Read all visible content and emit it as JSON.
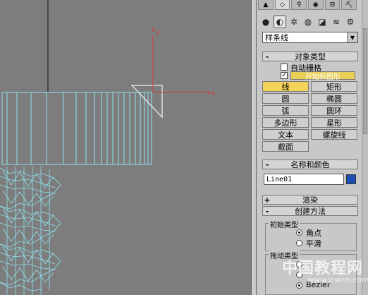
{
  "viewport": {
    "axis_y_label": "y",
    "axis_x_label": "x"
  },
  "panel": {
    "tabs": [
      "▲",
      "◇",
      "⚲",
      "◉",
      "⊟",
      "⛏"
    ],
    "icons": [
      {
        "name": "geometry-icon",
        "glyph": "●"
      },
      {
        "name": "shapes-icon",
        "glyph": "◐"
      },
      {
        "name": "lights-icon",
        "glyph": "✲"
      },
      {
        "name": "cameras-icon",
        "glyph": "◍"
      },
      {
        "name": "helpers-icon",
        "glyph": "◪"
      },
      {
        "name": "spacewarps-icon",
        "glyph": "≋"
      },
      {
        "name": "systems-icon",
        "glyph": "⚙"
      }
    ],
    "category_dropdown": "样条线",
    "object_type": {
      "title": "对象类型",
      "auto_grid": "自动栅格",
      "start_new_shape": "开始新图形",
      "buttons": [
        "线",
        "矩形",
        "圆",
        "椭圆",
        "弧",
        "圆环",
        "多边形",
        "星形",
        "文本",
        "螺旋线",
        "截面"
      ]
    },
    "name_color": {
      "title": "名称和颜色",
      "name_value": "Line01",
      "color": "#1a4fb8"
    },
    "render": {
      "title": "渲染",
      "sign": "+"
    },
    "creation_method": {
      "title": "创建方法",
      "initial_type": "初始类型",
      "corner": "角点",
      "smooth": "平滑",
      "drag_type": "拖动类型",
      "bezier": "Bezier"
    },
    "minus": "-"
  },
  "watermark": {
    "main": "中国教程网",
    "sub": "www.jcwcn.com"
  }
}
